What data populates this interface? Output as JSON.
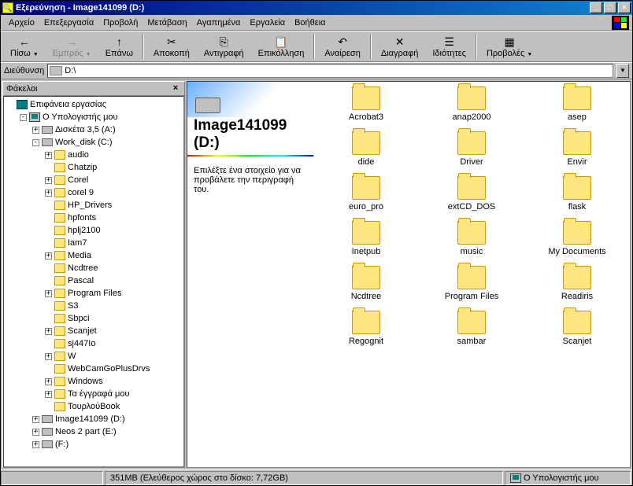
{
  "window": {
    "title": "Εξερεύνηση - Image141099 (D:)"
  },
  "menu": [
    "Αρχείο",
    "Επεξεργασία",
    "Προβολή",
    "Μετάβαση",
    "Αγαπημένα",
    "Εργαλεία",
    "Βοήθεια"
  ],
  "toolbar": [
    {
      "label": "Πίσω",
      "icon": "←",
      "disabled": false,
      "arrow": true
    },
    {
      "label": "Εμπρός",
      "icon": "→",
      "disabled": true,
      "arrow": true
    },
    {
      "label": "Επάνω",
      "icon": "↑",
      "disabled": false
    },
    {
      "sep": true
    },
    {
      "label": "Αποκοπή",
      "icon": "✂",
      "disabled": false
    },
    {
      "label": "Αντιγραφή",
      "icon": "⎘",
      "disabled": false
    },
    {
      "label": "Επικόλληση",
      "icon": "📋",
      "disabled": false
    },
    {
      "sep": true
    },
    {
      "label": "Αναίρεση",
      "icon": "↶",
      "disabled": false
    },
    {
      "sep": true
    },
    {
      "label": "Διαγραφή",
      "icon": "✕",
      "disabled": false
    },
    {
      "label": "Ιδιότητες",
      "icon": "☰",
      "disabled": false
    },
    {
      "sep": true
    },
    {
      "label": "Προβολές",
      "icon": "▦",
      "disabled": false,
      "arrow": true
    }
  ],
  "address": {
    "label": "Διεύθυνση",
    "value": "D:\\"
  },
  "sidebar": {
    "title": "Φάκελοι"
  },
  "tree": [
    {
      "d": 0,
      "exp": "",
      "ico": "desktop",
      "label": "Επιφάνεια εργασίας"
    },
    {
      "d": 1,
      "exp": "-",
      "ico": "computer",
      "label": "Ο Υπολογιστής μου"
    },
    {
      "d": 2,
      "exp": "+",
      "ico": "drive",
      "label": "Δισκέτα 3,5 (A:)"
    },
    {
      "d": 2,
      "exp": "-",
      "ico": "drive",
      "label": "Work_disk (C:)"
    },
    {
      "d": 3,
      "exp": "+",
      "ico": "folder",
      "label": "audio"
    },
    {
      "d": 3,
      "exp": "",
      "ico": "folder",
      "label": "Chatzip"
    },
    {
      "d": 3,
      "exp": "+",
      "ico": "folder",
      "label": "Corel"
    },
    {
      "d": 3,
      "exp": "+",
      "ico": "folder",
      "label": "corel 9"
    },
    {
      "d": 3,
      "exp": "",
      "ico": "folder",
      "label": "HP_Drivers"
    },
    {
      "d": 3,
      "exp": "",
      "ico": "folder",
      "label": "hpfonts"
    },
    {
      "d": 3,
      "exp": "",
      "ico": "folder",
      "label": "hplj2100"
    },
    {
      "d": 3,
      "exp": "",
      "ico": "folder",
      "label": "Iam7"
    },
    {
      "d": 3,
      "exp": "+",
      "ico": "folder",
      "label": "Media"
    },
    {
      "d": 3,
      "exp": "",
      "ico": "folder",
      "label": "Ncdtree"
    },
    {
      "d": 3,
      "exp": "",
      "ico": "folder",
      "label": "Pascal"
    },
    {
      "d": 3,
      "exp": "+",
      "ico": "folder",
      "label": "Program Files"
    },
    {
      "d": 3,
      "exp": "",
      "ico": "folder",
      "label": "S3"
    },
    {
      "d": 3,
      "exp": "",
      "ico": "folder",
      "label": "Sbpci"
    },
    {
      "d": 3,
      "exp": "+",
      "ico": "folder",
      "label": "Scanjet"
    },
    {
      "d": 3,
      "exp": "",
      "ico": "folder",
      "label": "sj447Ιο"
    },
    {
      "d": 3,
      "exp": "+",
      "ico": "folder",
      "label": "W"
    },
    {
      "d": 3,
      "exp": "",
      "ico": "folder",
      "label": "WebCamGoPlusDrvs"
    },
    {
      "d": 3,
      "exp": "+",
      "ico": "folder",
      "label": "Windows"
    },
    {
      "d": 3,
      "exp": "+",
      "ico": "folder",
      "label": "Τα έγγραφά μου"
    },
    {
      "d": 3,
      "exp": "",
      "ico": "folder",
      "label": "ΤουρλούBook"
    },
    {
      "d": 2,
      "exp": "+",
      "ico": "drive",
      "label": "Image141099 (D:)"
    },
    {
      "d": 2,
      "exp": "+",
      "ico": "drive",
      "label": "Neos 2 part (E:)"
    },
    {
      "d": 2,
      "exp": "+",
      "ico": "drive",
      "label": "(F:)"
    }
  ],
  "webview": {
    "title": "Image141099 (D:)",
    "desc": "Επιλέξτε ένα στοιχείο για να προβάλετε την περιγραφή του."
  },
  "folders": [
    "Acrobat3",
    "anap2000",
    "asep",
    "dide",
    "Driver",
    "Envir",
    "euro_pro",
    "extCD_DOS",
    "flask",
    "Inetpub",
    "music",
    "My Documents",
    "Ncdtree",
    "Program Files",
    "Readiris",
    "Regognit",
    "sambar",
    "Scanjet"
  ],
  "status": {
    "size": "351MB",
    "free": "(Ελεύθερος χώρος στο δίσκο: 7,72GB)",
    "zone": "Ο Υπολογιστής μου"
  }
}
